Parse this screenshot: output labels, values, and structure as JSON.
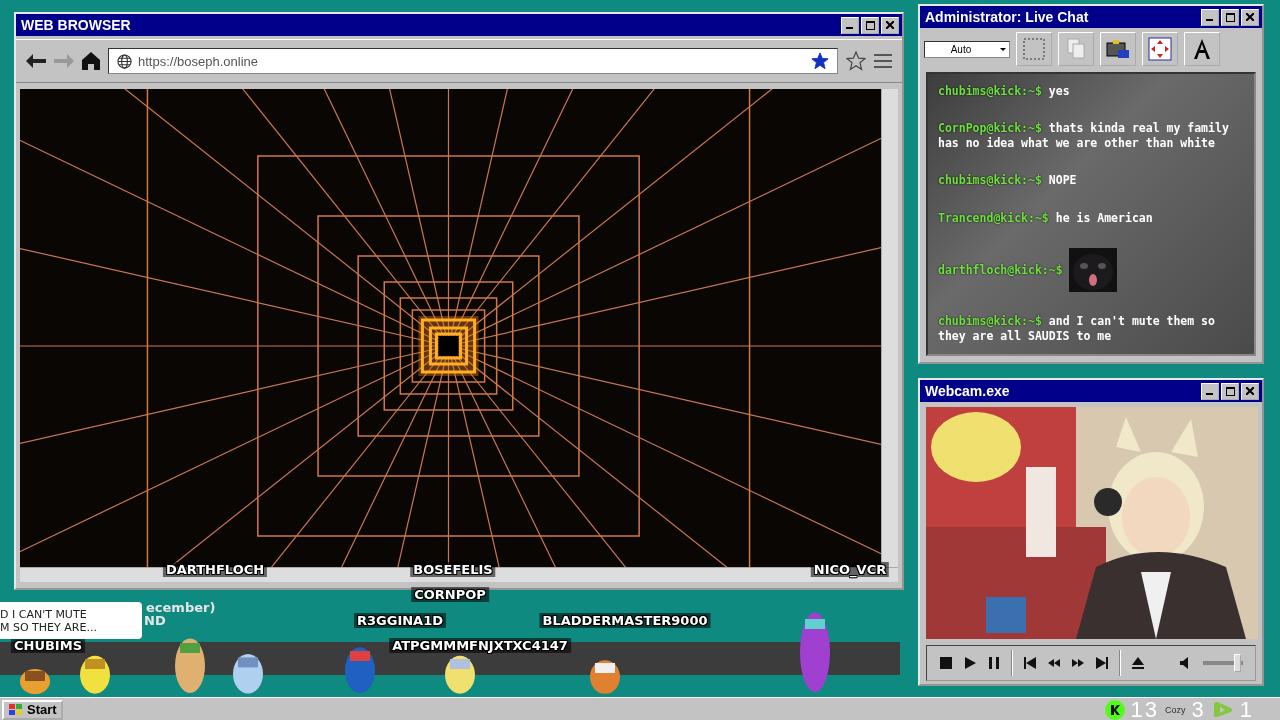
{
  "browser": {
    "title": "WEB BROWSER",
    "url": "https://boseph.online",
    "bookmarked": true
  },
  "stage": {
    "names": [
      {
        "name": "DARTHFLOCH"
      },
      {
        "name": "BOSEFELIS"
      },
      {
        "name": "NICO_VCR"
      },
      {
        "name": "CORNPOP"
      },
      {
        "name": "R3GGINA1D"
      },
      {
        "name": "BLADDERMASTER9000"
      },
      {
        "name": "CHUBIMS"
      },
      {
        "name": "ATPGMMMFNJXTXC4147"
      }
    ],
    "bubble": {
      "lines": [
        "D I CAN'T MUTE",
        "M SO THEY ARE..."
      ]
    },
    "hidden_fragments": [
      "ecember)",
      "ND"
    ]
  },
  "chat": {
    "title": "Administrator: Live Chat",
    "font_size": "Auto",
    "messages": [
      {
        "kind": "text",
        "user": "chubims@kick:~$",
        "text": "yes"
      },
      {
        "kind": "text",
        "user": "CornPop@kick:~$",
        "text": "thats kinda real my family has no idea what we are other than white"
      },
      {
        "kind": "text",
        "user": "chubims@kick:~$",
        "text": "NOPE"
      },
      {
        "kind": "text",
        "user": "Trancend@kick:~$",
        "text": "he is American"
      },
      {
        "user": "darthfloch@kick:~$"
      },
      {
        "kind": "text",
        "user": "chubims@kick:~$",
        "text": "and I can't mute them so they are all SAUDIS to me"
      }
    ]
  },
  "webcam": {
    "title": "Webcam.exe",
    "volume": {
      "level": 0.85
    }
  },
  "taskbar": {
    "start": "Start",
    "counters": [
      {
        "kind": "kick",
        "value": "13"
      },
      {
        "kind": "cozy",
        "label": "Cozy",
        "value": "3"
      },
      {
        "kind": "rumble",
        "value": "1"
      }
    ]
  }
}
